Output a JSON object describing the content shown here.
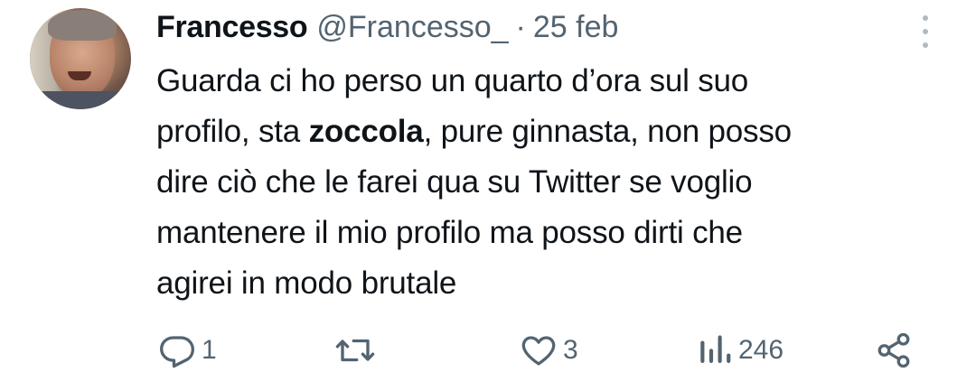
{
  "tweet": {
    "author": {
      "name": "Francesso",
      "handle": "@Francesso_",
      "separator": "·",
      "date": "25 feb",
      "avatar_icon": "user-avatar"
    },
    "text_lines": [
      {
        "before": "Guarda ci ho perso un quarto d’ora sul suo",
        "bold": "",
        "after": ""
      },
      {
        "before": "profilo, sta ",
        "bold": "zoccola",
        "after": ", pure ginnasta, non posso"
      },
      {
        "before": "dire ciò che le farei qua su Twitter se voglio",
        "bold": "",
        "after": ""
      },
      {
        "before": "mantenere il mio profilo ma posso dirti che",
        "bold": "",
        "after": ""
      },
      {
        "before": "agirei in modo brutale",
        "bold": "",
        "after": ""
      }
    ],
    "actions": {
      "reply": {
        "icon": "reply-icon",
        "count": "1"
      },
      "retweet": {
        "icon": "retweet-icon",
        "count": ""
      },
      "like": {
        "icon": "heart-icon",
        "count": "3"
      },
      "views": {
        "icon": "views-icon",
        "count": "246"
      },
      "share": {
        "icon": "share-icon",
        "count": ""
      }
    },
    "colors": {
      "text": "#0f1419",
      "secondary": "#536471",
      "background": "#ffffff"
    }
  }
}
